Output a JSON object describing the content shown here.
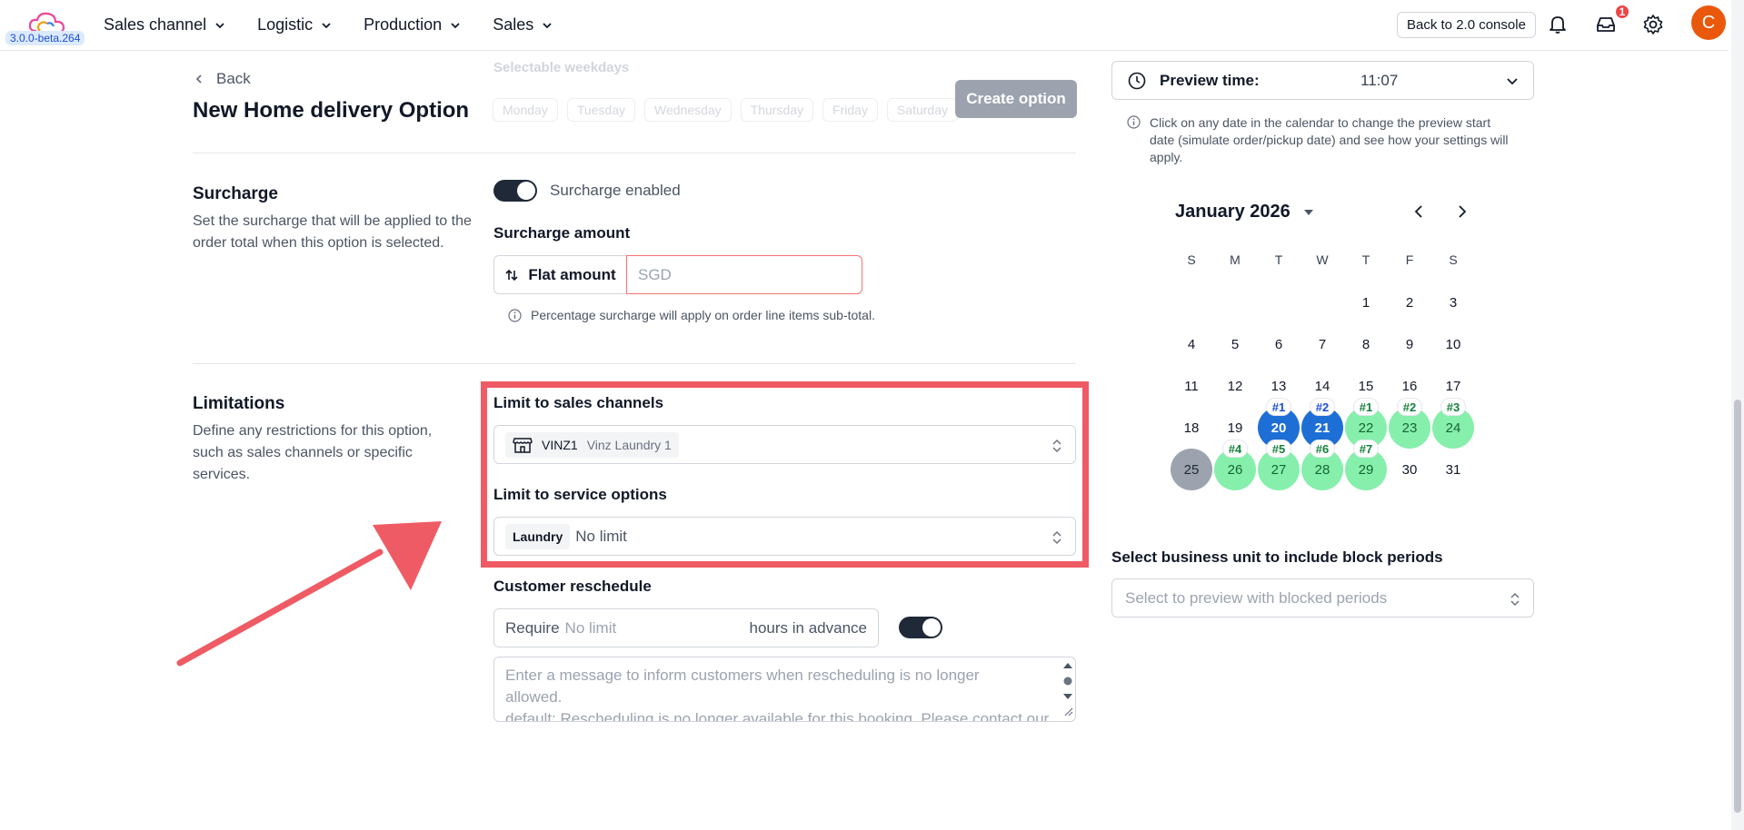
{
  "topbar": {
    "version": "3.0.0-beta.264",
    "nav": [
      {
        "label": "Sales channel"
      },
      {
        "label": "Logistic"
      },
      {
        "label": "Production"
      },
      {
        "label": "Sales"
      }
    ],
    "back_console": "Back to 2.0 console",
    "inbox_badge": "1",
    "avatar_initial": "C"
  },
  "header": {
    "back_label": "Back",
    "title": "New Home delivery Option",
    "create_label": "Create option",
    "ghost_text": "Selectable weekdays",
    "ghost_chips": [
      "Monday",
      "Tuesday",
      "Wednesday",
      "Thursday",
      "Friday",
      "Saturday"
    ]
  },
  "surcharge": {
    "title": "Surcharge",
    "description": "Set the surcharge that will be applied to the order total when this option is selected.",
    "toggle_label": "Surcharge enabled",
    "toggle_on": true,
    "amount_label": "Surcharge amount",
    "type_label": "Flat amount",
    "amount_placeholder": "SGD",
    "note": "Percentage surcharge will apply on order line items sub-total."
  },
  "limitations": {
    "title": "Limitations",
    "description": "Define any restrictions for this option, such as sales channels or specific services.",
    "sales_channels_label": "Limit to sales channels",
    "sales_channel_chip": {
      "code": "VINZ1",
      "name": "Vinz Laundry 1"
    },
    "service_options_label": "Limit to service options",
    "service_chip": "Laundry",
    "service_value": "No limit"
  },
  "reschedule": {
    "label": "Customer reschedule",
    "prefix": "Require",
    "value": "No limit",
    "suffix": "hours in advance",
    "toggle_on": true,
    "message_placeholder_line1": "Enter a message to inform customers when rescheduling is no longer allowed.",
    "message_placeholder_line2": "default: Rescheduling is no longer available for this booking. Please contact our"
  },
  "preview": {
    "label": "Preview time:",
    "time": "11:07",
    "note": "Click on any date in the calendar to change the preview start date (simulate order/pickup date) and see how your settings will apply."
  },
  "calendar": {
    "month": "January 2026",
    "weekdays": [
      "S",
      "M",
      "T",
      "W",
      "T",
      "F",
      "S"
    ],
    "weeks": [
      [
        "",
        "",
        "",
        "",
        "1",
        "2",
        "3"
      ],
      [
        "4",
        "5",
        "6",
        "7",
        "8",
        "9",
        "10"
      ],
      [
        "11",
        "12",
        "13",
        "14",
        "15",
        "16",
        "17"
      ],
      [
        "18",
        "19",
        "20",
        "21",
        "22",
        "23",
        "24"
      ],
      [
        "25",
        "26",
        "27",
        "28",
        "29",
        "30",
        "31"
      ]
    ],
    "highlights": {
      "20": {
        "style": "blue",
        "pin": "#1"
      },
      "21": {
        "style": "blue",
        "pin": "#2"
      },
      "22": {
        "style": "green",
        "pin": "#1"
      },
      "23": {
        "style": "green",
        "pin": "#2"
      },
      "24": {
        "style": "green",
        "pin": "#3"
      },
      "25": {
        "style": "gray",
        "pin": ""
      },
      "26": {
        "style": "green",
        "pin": "#4"
      },
      "27": {
        "style": "green",
        "pin": "#5"
      },
      "28": {
        "style": "green",
        "pin": "#6"
      },
      "29": {
        "style": "green",
        "pin": "#7"
      }
    }
  },
  "business_unit": {
    "label": "Select business unit to include block periods",
    "placeholder": "Select to preview with blocked periods"
  },
  "colors": {
    "highlight_box": "#ef5b64",
    "arrow": "#ef5b64",
    "blue_day": "#1d6fd6",
    "green_day": "#86efac",
    "avatar": "#ea580c"
  }
}
